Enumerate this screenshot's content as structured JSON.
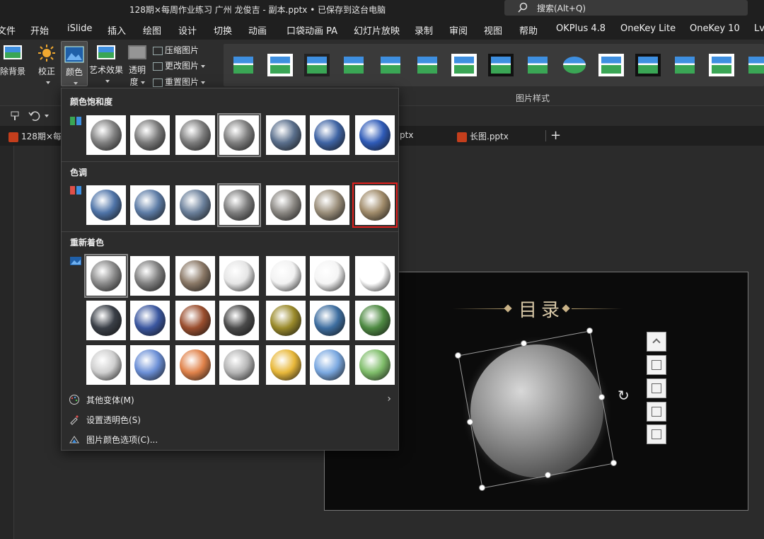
{
  "title_bar": {
    "title": "128期×每周作业练习 广州 龙俊吉 - 副本.pptx • 已保存到这台电脑",
    "search_placeholder": "搜索(Alt+Q)"
  },
  "menu_tabs": [
    "文件",
    "开始",
    "iSlide",
    "插入",
    "绘图",
    "设计",
    "切换",
    "动画",
    "口袋动画 PA",
    "幻灯片放映",
    "录制",
    "审阅",
    "视图",
    "帮助",
    "OKPlus 4.8",
    "OneKey Lite",
    "OneKey 10",
    "Lv"
  ],
  "ribbon": {
    "remove_bg": "除背景",
    "corrections": "校正",
    "color": "颜色",
    "artistic": "艺术效果",
    "transparency_1": "透明",
    "transparency_2": "度",
    "compress": "压缩图片",
    "change": "更改图片",
    "reset": "重置图片",
    "styles_label": "图片样式"
  },
  "doc_tabs": {
    "tab1": "128期×每",
    "tab2": "ptx",
    "tab3": "长图.pptx",
    "new_tab": "+"
  },
  "slide": {
    "title": "目录"
  },
  "color_menu": {
    "saturation_title": "颜色饱和度",
    "tone_title": "色调",
    "recolor_title": "重新着色",
    "saturation": [
      "#808080",
      "#7a7a7a",
      "#7c7c7c",
      "#7f7f7f",
      "#5a6f8c",
      "#3f64a4",
      "#2f5bb8"
    ],
    "tone": [
      "#4f74a8",
      "#5d7ca6",
      "#6a7f9a",
      "#7d7d7d",
      "#8a8782",
      "#9a8e7a",
      "#a08b6a"
    ],
    "recolor_row1": [
      "#8a8a8a",
      "#808080",
      "#8a7866",
      "#e6e6e6",
      "#f2f2f2",
      "#f5f5f5",
      "#ffffff"
    ],
    "recolor_row2": [
      "#3a3f47",
      "#3b57a0",
      "#9a4e2e",
      "#4a4a4a",
      "#9a8a2a",
      "#3e6ea0",
      "#4e8a42"
    ],
    "recolor_row3": [
      "#cfcfcf",
      "#6b8fd6",
      "#e0824a",
      "#b5b5b5",
      "#e8b83a",
      "#7aa8e0",
      "#7fbd6a"
    ],
    "more_variations": "其他变体(M)",
    "set_transparent": "设置透明色(S)",
    "color_options": "图片颜色选项(C)..."
  }
}
